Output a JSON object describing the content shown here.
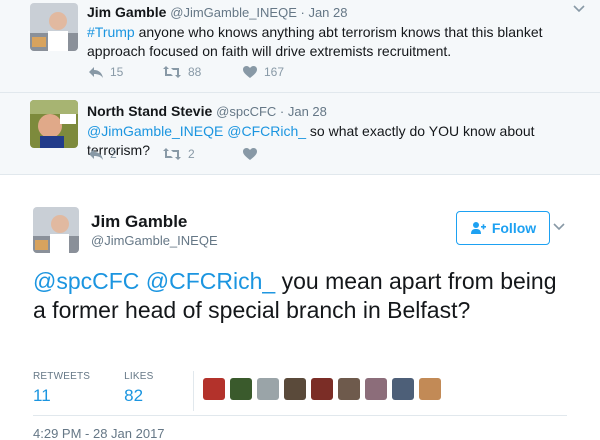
{
  "tweets": [
    {
      "name": "Jim Gamble",
      "handle": "@JimGamble_INEQE",
      "sep": " · ",
      "date": "Jan 28",
      "text_link": "#Trump",
      "text": " anyone who knows anything abt terrorism knows that this blanket approach focused on faith will drive extremists recruitment.",
      "replies": "15",
      "retweets": "88",
      "likes": "167"
    },
    {
      "name": "North Stand Stevie",
      "handle": "@spcCFC",
      "sep": " · ",
      "date": "Jan 28",
      "text_link": "@JimGamble_INEQE @CFCRich_",
      "text": " so what exactly do YOU know about terrorism?",
      "replies": "2",
      "retweets": "2",
      "likes": ""
    }
  ],
  "main": {
    "name": "Jim Gamble",
    "handle": "@JimGamble_INEQE",
    "follow_label": "Follow",
    "text_link": "@spcCFC @CFCRich_",
    "text": " you mean apart from being a former head of special branch in Belfast?",
    "retweets_label": "RETWEETS",
    "retweets_value": "11",
    "likes_label": "LIKES",
    "likes_value": "82",
    "timestamp": "4:29 PM - 28 Jan 2017"
  },
  "icons": {
    "reply": "reply-icon",
    "retweet": "retweet-icon",
    "like": "heart-icon",
    "caret": "chevron-down-icon",
    "follow": "follow-user-icon"
  },
  "colors": {
    "link": "#1b95e0",
    "muted": "#657786",
    "action": "#8899a6",
    "reply_bg": "#f5f8fa"
  }
}
